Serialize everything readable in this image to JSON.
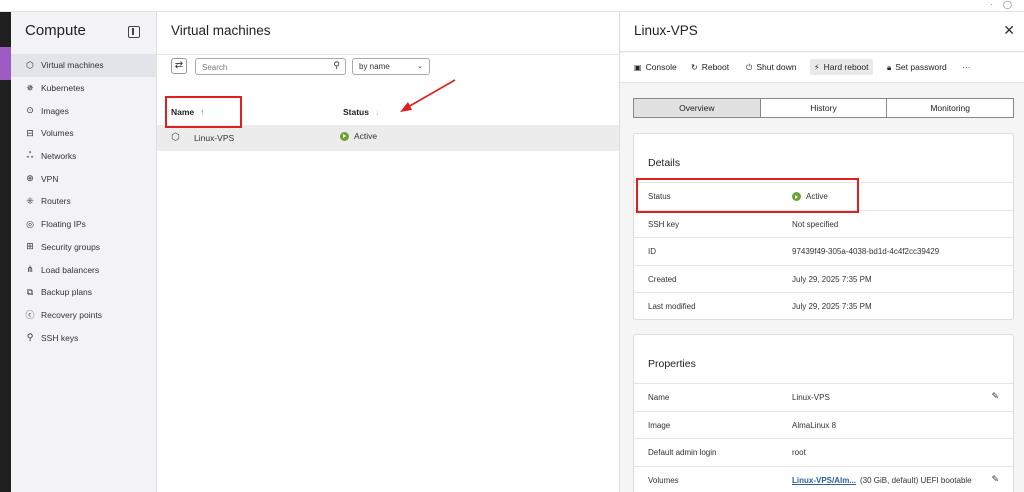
{
  "sidebar": {
    "title": "Compute",
    "items": [
      {
        "label": "Virtual machines",
        "icon": "⬡",
        "active": true
      },
      {
        "label": "Kubernetes",
        "icon": "✵"
      },
      {
        "label": "Images",
        "icon": "⊙"
      },
      {
        "label": "Volumes",
        "icon": "⊟"
      },
      {
        "label": "Networks",
        "icon": "ஃ"
      },
      {
        "label": "VPN",
        "icon": "⊕"
      },
      {
        "label": "Routers",
        "icon": "⁜"
      },
      {
        "label": "Floating IPs",
        "icon": "◎"
      },
      {
        "label": "Security groups",
        "icon": "⊞"
      },
      {
        "label": "Load balancers",
        "icon": "⋔"
      },
      {
        "label": "Backup plans",
        "icon": "⧉"
      },
      {
        "label": "Recovery points",
        "icon": "ⓒ"
      },
      {
        "label": "SSH keys",
        "icon": "⚲"
      }
    ]
  },
  "main": {
    "title": "Virtual machines",
    "search_placeholder": "Search",
    "sort_value": "by name",
    "col_name": "Name",
    "col_status": "Status",
    "rows": [
      {
        "name": "Linux-VPS",
        "status": "Active"
      }
    ]
  },
  "panel": {
    "title": "Linux-VPS",
    "toolbar": {
      "console": "Console",
      "reboot": "Reboot",
      "shutdown": "Shut down",
      "hard_reboot": "Hard reboot",
      "set_password": "Set password",
      "more": "···"
    },
    "tabs": [
      "Overview",
      "History",
      "Monitoring"
    ],
    "details": {
      "title": "Details",
      "rows": [
        {
          "key": "Status",
          "value": "Active"
        },
        {
          "key": "SSH key",
          "value": "Not specified"
        },
        {
          "key": "ID",
          "value": "97439f49-305a-4038-bd1d-4c4f2cc39429"
        },
        {
          "key": "Created",
          "value": "July 29, 2025 7:35 PM"
        },
        {
          "key": "Last modified",
          "value": "July 29, 2025 7:35 PM"
        }
      ]
    },
    "properties": {
      "title": "Properties",
      "rows": [
        {
          "key": "Name",
          "value": "Linux-VPS"
        },
        {
          "key": "Image",
          "value": "AlmaLinux 8"
        },
        {
          "key": "Default admin login",
          "value": "root"
        },
        {
          "key": "Volumes",
          "link": "Linux-VPS/Alm...",
          "value": "(30 GiB, default) UEFI bootable"
        }
      ]
    }
  },
  "colors": {
    "accent": "#9c5cc4",
    "active_status": "#6aa336",
    "highlight": "#e02020",
    "link": "#2c5f9e"
  }
}
